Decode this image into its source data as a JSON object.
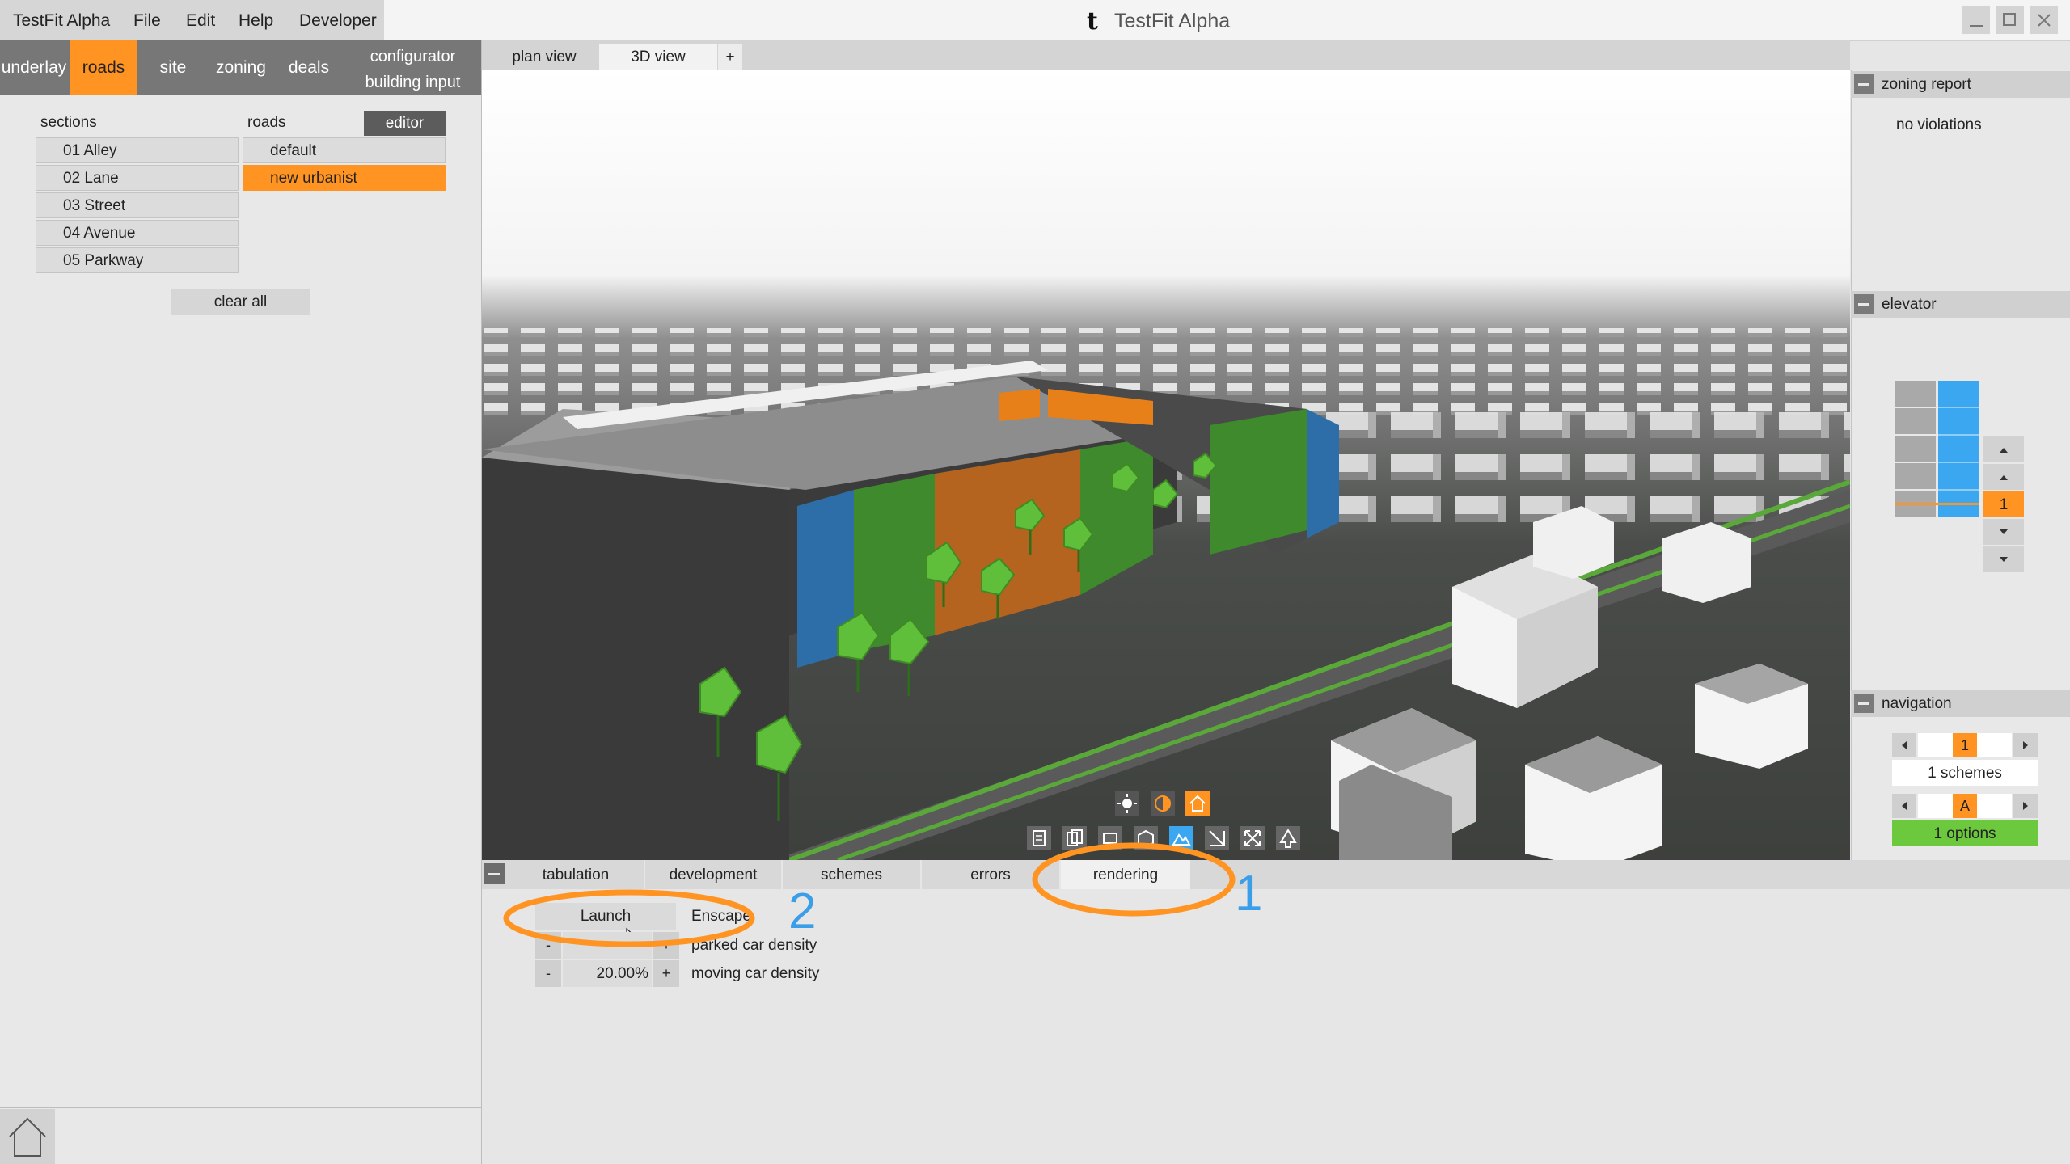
{
  "menubar": {
    "app_name": "TestFit Alpha",
    "file": "File",
    "edit": "Edit",
    "help": "Help",
    "developer": "Developer"
  },
  "window": {
    "title": "TestFit Alpha",
    "logo_glyph": "t"
  },
  "topnav": {
    "underlay": "underlay",
    "roads": "roads",
    "site": "site",
    "zoning": "zoning",
    "deals": "deals",
    "configurator": "configurator",
    "building_input": "building input"
  },
  "roads_panel": {
    "sections_label": "sections",
    "roads_label": "roads",
    "editor_label": "editor",
    "sections": [
      "01 Alley",
      "02 Lane",
      "03 Street",
      "04 Avenue",
      "05 Parkway"
    ],
    "roads": [
      "default",
      "new urbanist"
    ],
    "selected_road": "new urbanist",
    "clear_all": "clear all"
  },
  "view_tabs": {
    "plan": "plan view",
    "threed": "3D view",
    "add": "+",
    "active": "3D view"
  },
  "right_panel": {
    "zoning_report": "zoning report",
    "zoning_status": "no violations",
    "elevator": "elevator",
    "elevator_level": "1",
    "navigation": "navigation",
    "scheme_value": "1",
    "schemes_text": "1 schemes",
    "option_value": "A",
    "options_text": "1 options"
  },
  "bottom_tabs": {
    "tabulation": "tabulation",
    "development": "development",
    "schemes": "schemes",
    "errors": "errors",
    "rendering": "rendering",
    "active": "rendering"
  },
  "rendering_panel": {
    "launch": "Launch",
    "enscape": "Enscape",
    "parked_label": "parked car density",
    "moving_value": "20.00%",
    "moving_label": "moving car density",
    "minus": "-",
    "plus": "+"
  },
  "annotations": {
    "one": "1",
    "two": "2"
  },
  "colors": {
    "accent": "#ff9422",
    "blue": "#3aa7f0",
    "green": "#6cc83c",
    "annotation": "#ff9422"
  }
}
